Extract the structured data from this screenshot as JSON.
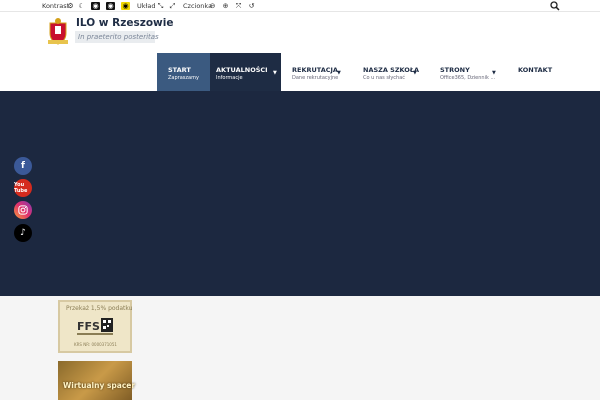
{
  "toolbar": {
    "contrast_label": "Kontrast",
    "layout_label": "Układ",
    "font_label": "Czcionka"
  },
  "header": {
    "title": "ILO w Rzeszowie",
    "motto": "In praeterito posteritas"
  },
  "nav": {
    "items": [
      {
        "label": "START",
        "sub": "Zapraszamy"
      },
      {
        "label": "AKTUALNOŚCI",
        "sub": "Informacje"
      },
      {
        "label": "REKRUTACJA",
        "sub": "Dane rekrutacyjne"
      },
      {
        "label": "NASZA SZKOŁA",
        "sub": "Co u nas słychać"
      },
      {
        "label": "STRONY",
        "sub": "Office365, Dziennik ..."
      },
      {
        "label": "KONTAKT",
        "sub": ""
      }
    ]
  },
  "social": {
    "youtube_text": "You Tube"
  },
  "banners": {
    "tax_title": "Przekaż 1,5% podatku",
    "tax_org": "FFS",
    "tax_bottom": "KRS NR: 0000371051",
    "tour_title": "Wirtualny spacer"
  },
  "colors": {
    "navy": "#1c2840",
    "nav_active": "#3b5a80",
    "nav_hover": "#1e2c44"
  }
}
